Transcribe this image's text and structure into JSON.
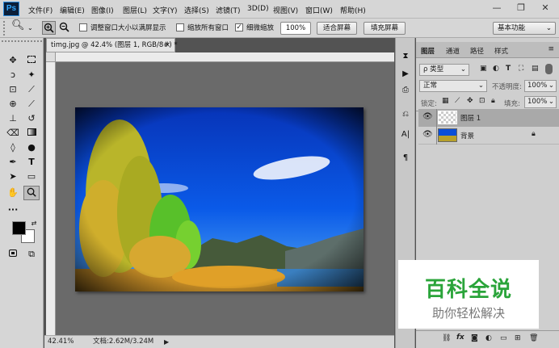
{
  "app": {
    "logo": "Ps"
  },
  "menu": [
    "文件(F)",
    "编辑(E)",
    "图像(I)",
    "图层(L)",
    "文字(Y)",
    "选择(S)",
    "滤镜(T)",
    "3D(D)",
    "视图(V)",
    "窗口(W)",
    "帮助(H)"
  ],
  "window_controls": {
    "minimize": "—",
    "restore": "❐",
    "close": "✕"
  },
  "options": {
    "resize_window": "调整窗口大小以满屏显示",
    "zoom_all": "缩放所有窗口",
    "scrubby_zoom": "细微缩放",
    "zoom_value": "100%",
    "fit_screen": "适合屏幕",
    "fill_screen": "填充屏幕",
    "workspace": "基本功能"
  },
  "document": {
    "tab": "timg.jpg @ 42.4% (图层 1, RGB/8#) *",
    "close": "×"
  },
  "status": {
    "zoom": "42.41%",
    "doc": "文档:2.62M/3.24M"
  },
  "layers_panel": {
    "tabs": [
      "图层",
      "通道",
      "路径",
      "样式"
    ],
    "filter": "ρ 类型",
    "blend": "正常",
    "opacity_label": "不透明度:",
    "opacity": "100%",
    "lock_label": "锁定:",
    "fill_label": "填充:",
    "fill": "100%",
    "layers": [
      {
        "name": "图层 1"
      },
      {
        "name": "背景"
      }
    ]
  },
  "watermark": {
    "title": "百科全说",
    "subtitle": "助你轻松解决"
  }
}
